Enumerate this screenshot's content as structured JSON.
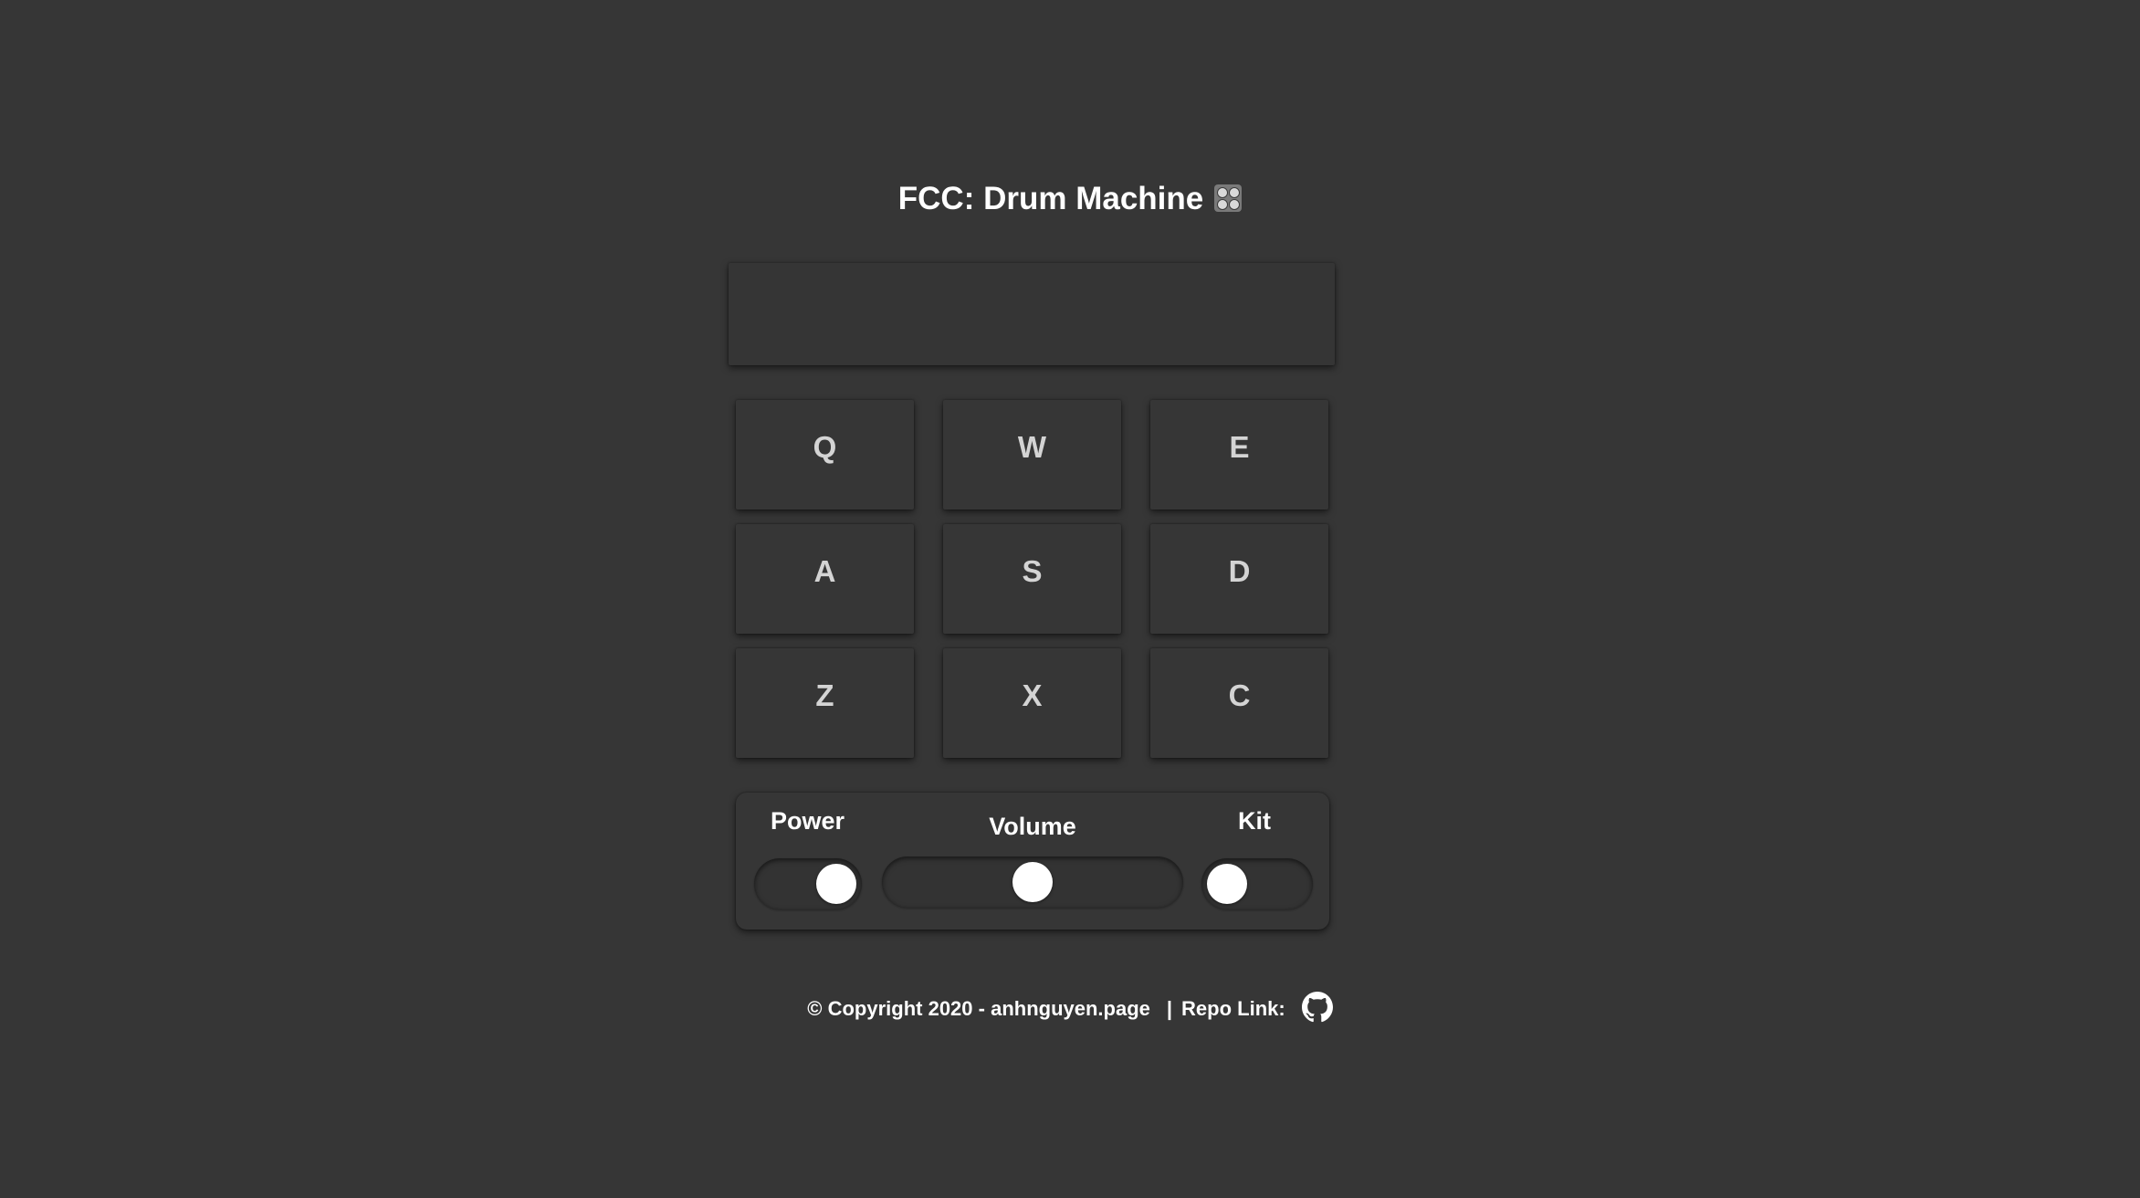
{
  "header": {
    "title": "FCC: Drum Machine",
    "title_icon": "control-knobs-icon"
  },
  "display": {
    "text": ""
  },
  "pads": [
    {
      "key": "Q"
    },
    {
      "key": "W"
    },
    {
      "key": "E"
    },
    {
      "key": "A"
    },
    {
      "key": "S"
    },
    {
      "key": "D"
    },
    {
      "key": "Z"
    },
    {
      "key": "X"
    },
    {
      "key": "C"
    }
  ],
  "controls": {
    "power_label": "Power",
    "power_on": true,
    "volume_label": "Volume",
    "volume_level": 0.5,
    "kit_label": "Kit",
    "kit_alternate": false
  },
  "footer": {
    "copyright": "© Copyright 2020 -",
    "site_link": "anhnguyen.page",
    "separator": "|",
    "repo_label": "Repo Link:",
    "repo_icon": "github-icon"
  }
}
